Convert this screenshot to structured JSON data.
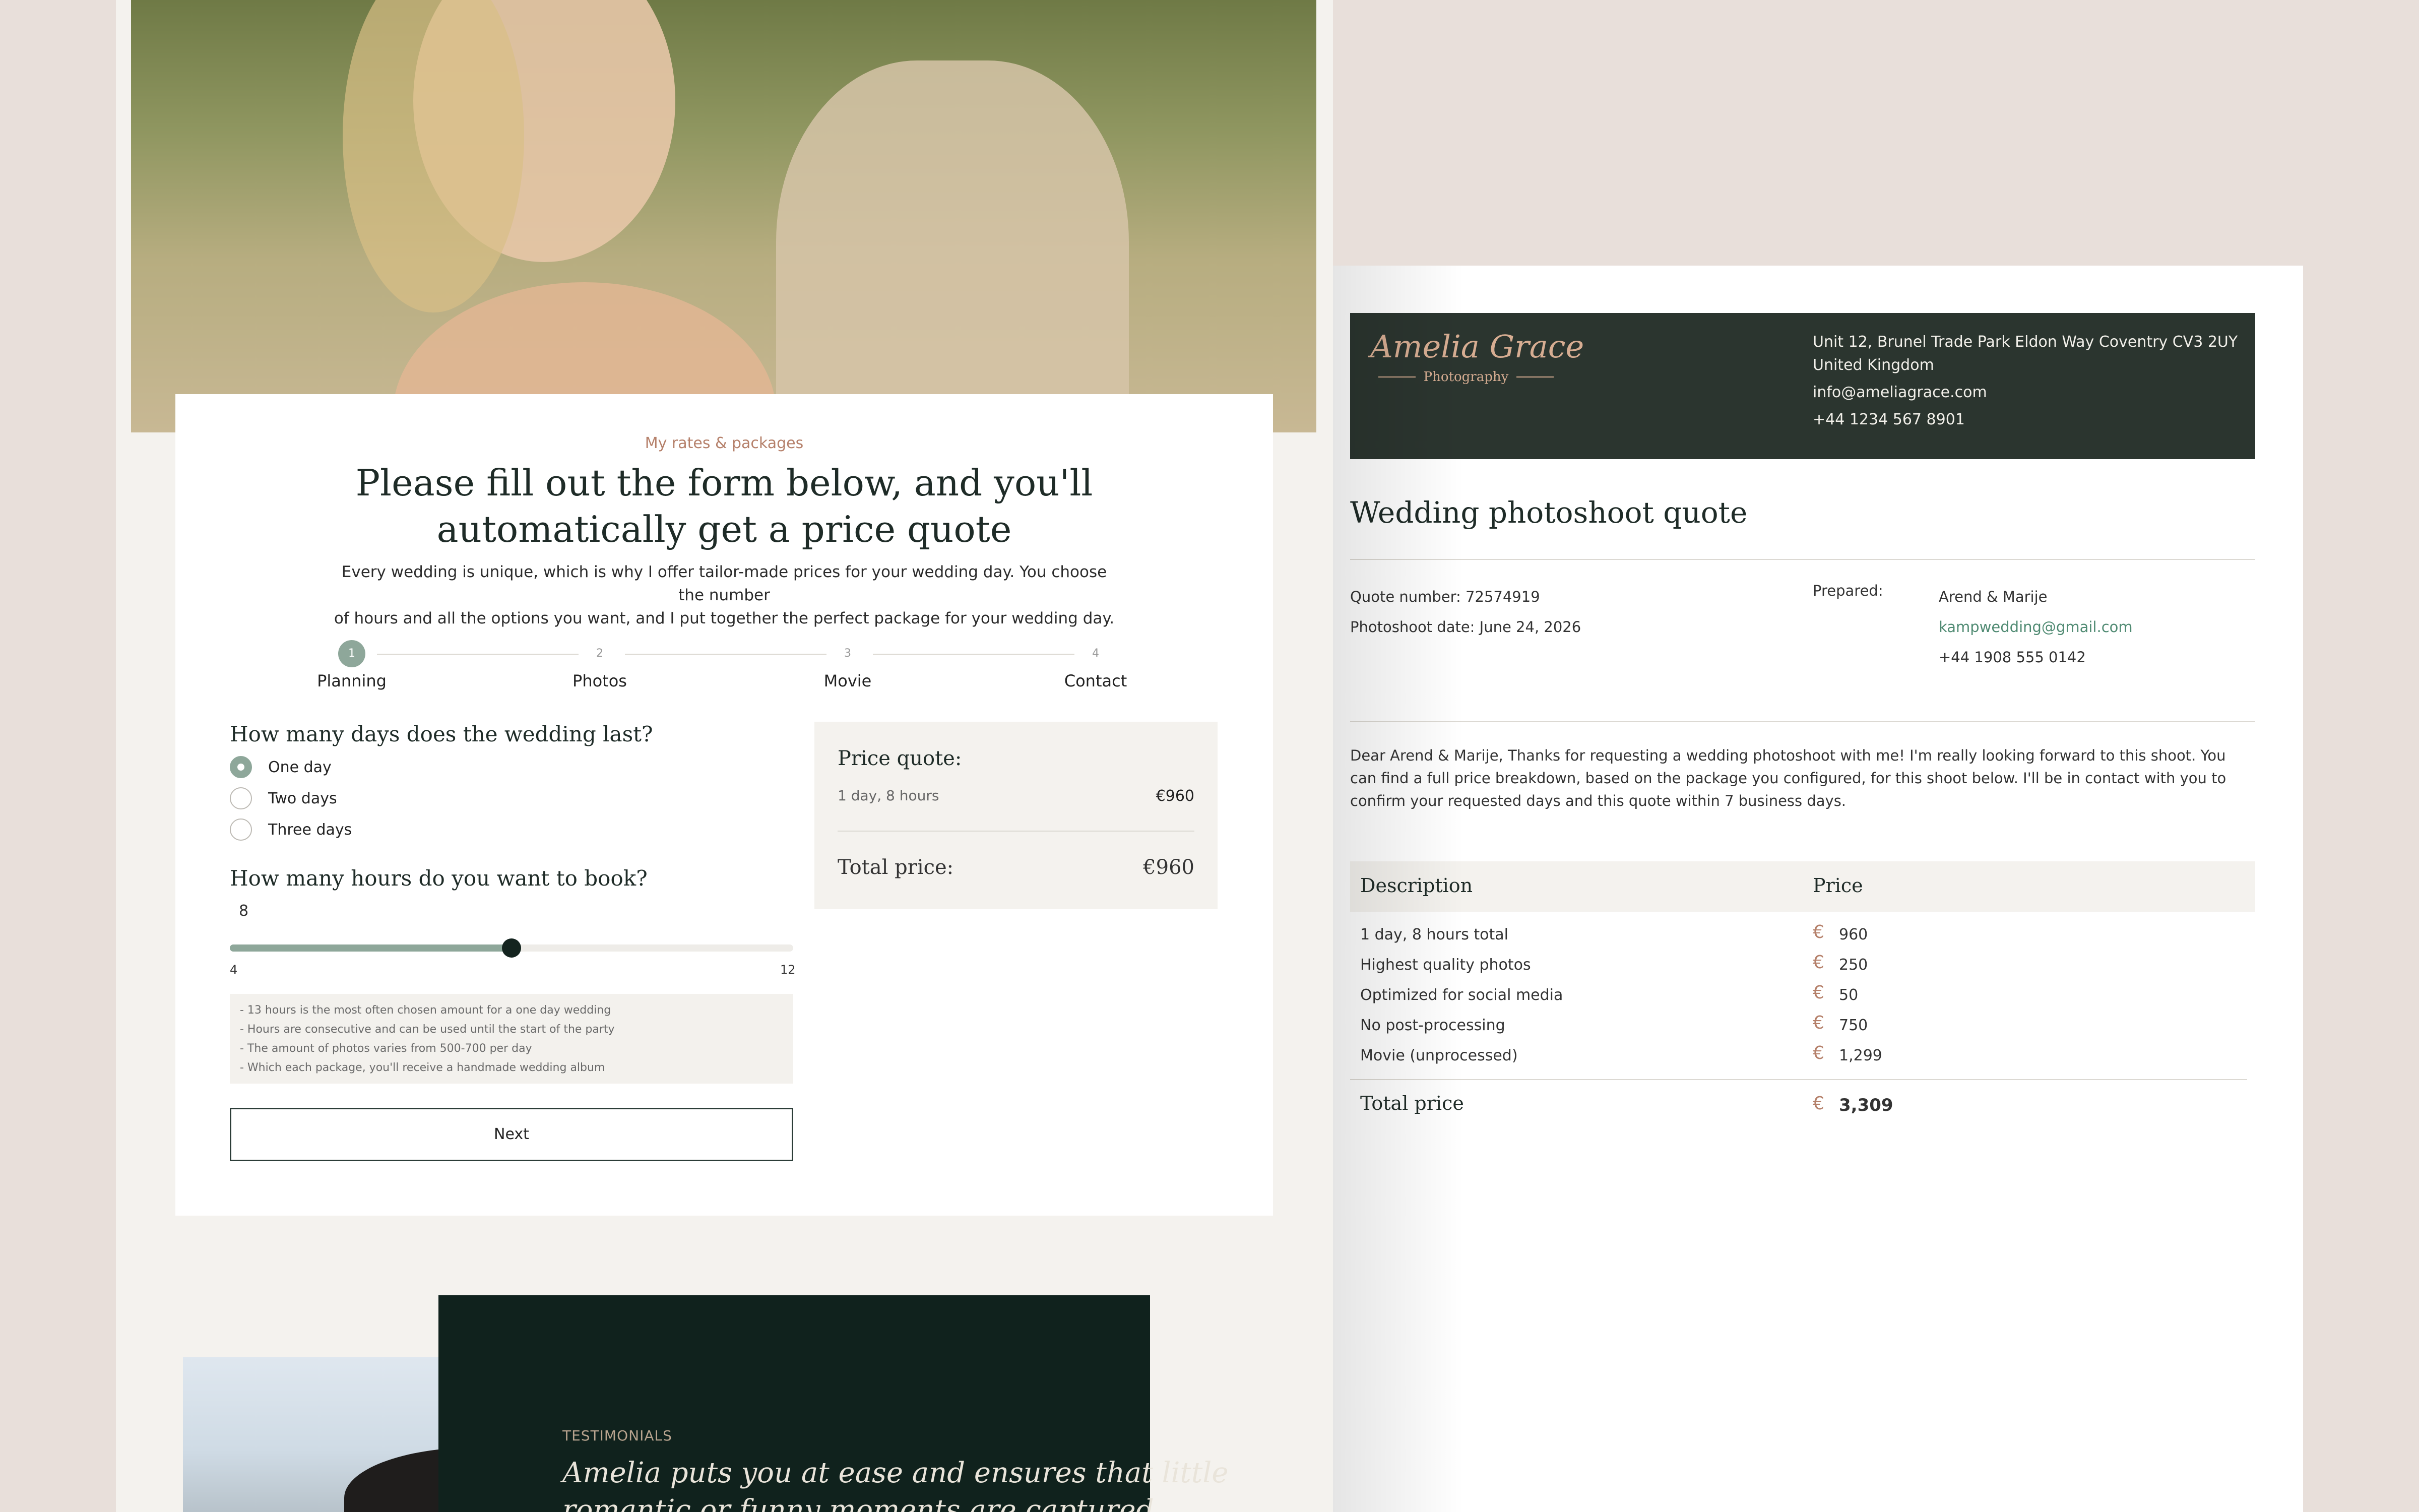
{
  "form": {
    "eyebrow": "My rates & packages",
    "title_line1": "Please fill out the form below, and you'll",
    "title_line2": "automatically get a price quote",
    "intro_line1": "Every wedding is unique, which is why I offer tailor-made prices for your wedding day. You choose the number",
    "intro_line2": "of hours and all the options you want, and I put together the perfect package for your wedding day.",
    "steps": [
      {
        "num": "1",
        "label": "Planning"
      },
      {
        "num": "2",
        "label": "Photos"
      },
      {
        "num": "3",
        "label": "Movie"
      },
      {
        "num": "4",
        "label": "Contact"
      }
    ],
    "active_step": 1,
    "days_question": "How many days does the wedding last?",
    "day_options": [
      "One day",
      "Two days",
      "Three days"
    ],
    "selected_day": "One day",
    "hours_question": "How many hours do you want to book?",
    "hours_value": "8",
    "slider": {
      "min": "4",
      "max": "12",
      "value": 8
    },
    "notes": [
      "- 13 hours is the most often chosen amount for a one day wedding",
      "- Hours are consecutive and can be used until the start of the party",
      "- The amount of photos varies from 500-700 per day",
      "- Which each package, you'll receive a handmade wedding album"
    ],
    "next_label": "Next",
    "quote": {
      "title": "Price quote:",
      "line_desc": "1 day, 8 hours",
      "line_price": "€960",
      "total_label": "Total price:",
      "total_price": "€960"
    }
  },
  "testimonials": {
    "eyebrow": "TESTIMONIALS",
    "quote_line1": "Amelia puts you at ease and ensures that little",
    "quote_line2": "romantic or funny moments are captured"
  },
  "doc": {
    "logo_main": "Amelia Grace",
    "logo_sub": "Photography",
    "address_line1": "Unit 12, Brunel Trade Park Eldon Way Coventry CV3 2UY",
    "address_line2": "United Kingdom",
    "email": "info@ameliagrace.com",
    "phone": "+44 1234 567 8901",
    "title": "Wedding photoshoot quote",
    "quote_number": "Quote number: 72574919",
    "photoshoot_date": "Photoshoot date: June 24, 2026",
    "prepared_label": "Prepared:",
    "client_name": "Arend & Marije",
    "client_email": "kampwedding@gmail.com",
    "client_phone": "+44 1908 555 0142",
    "letter": "Dear Arend & Marije, Thanks for requesting a wedding photoshoot with me! I'm really looking forward to this shoot. You can find a full price breakdown, based on the package you configured, for this shoot below. I'll be in contact with you to confirm your requested days and this quote within 7 business days.",
    "table": {
      "col_desc": "Description",
      "col_price": "Price",
      "currency": "€",
      "rows": [
        {
          "desc": "1 day, 8 hours total",
          "price": "960"
        },
        {
          "desc": "Highest quality photos",
          "price": "250"
        },
        {
          "desc": "Optimized for social media",
          "price": "50"
        },
        {
          "desc": "No post-processing",
          "price": "750"
        },
        {
          "desc": "Movie (unprocessed)",
          "price": "1,299"
        }
      ],
      "total_label": "Total price",
      "total_price": "3,309"
    }
  }
}
